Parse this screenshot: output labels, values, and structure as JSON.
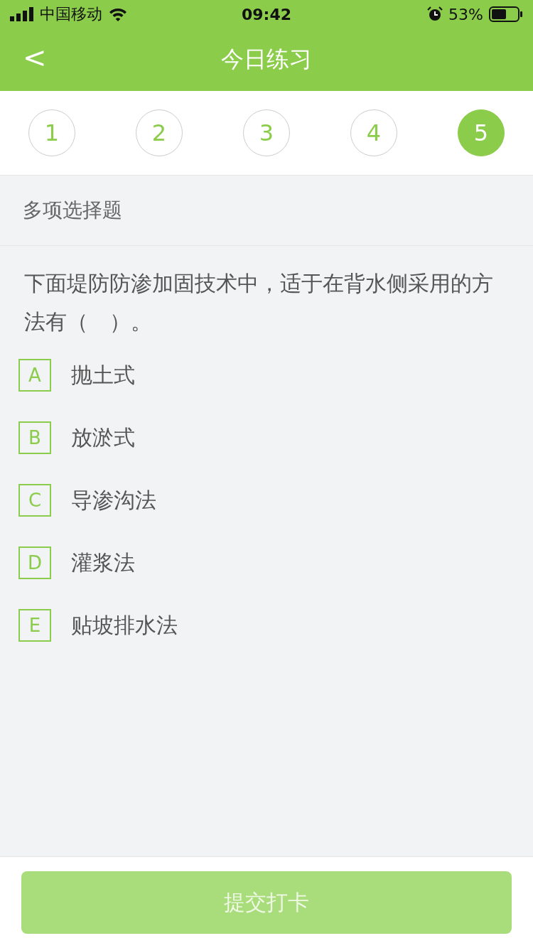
{
  "status_bar": {
    "carrier": "中国移动",
    "time": "09:42",
    "battery": "53%"
  },
  "nav": {
    "back": "<",
    "title": "今日练习"
  },
  "question_tabs": [
    {
      "label": "1",
      "selected": false
    },
    {
      "label": "2",
      "selected": false
    },
    {
      "label": "3",
      "selected": false
    },
    {
      "label": "4",
      "selected": false
    },
    {
      "label": "5",
      "selected": true
    }
  ],
  "section": "多项选择题",
  "question": "下面堤防防渗加固技术中，适于在背水侧采用的方法有（　）。",
  "options": [
    {
      "letter": "A",
      "text": "抛土式",
      "selected": false
    },
    {
      "letter": "B",
      "text": "放淤式",
      "selected": false
    },
    {
      "letter": "C",
      "text": "导渗沟法",
      "selected": false
    },
    {
      "letter": "D",
      "text": "灌浆法",
      "selected": false
    },
    {
      "letter": "E",
      "text": "贴坡排水法",
      "selected": false
    }
  ],
  "submit": {
    "label": "提交打卡",
    "disabled": true
  }
}
